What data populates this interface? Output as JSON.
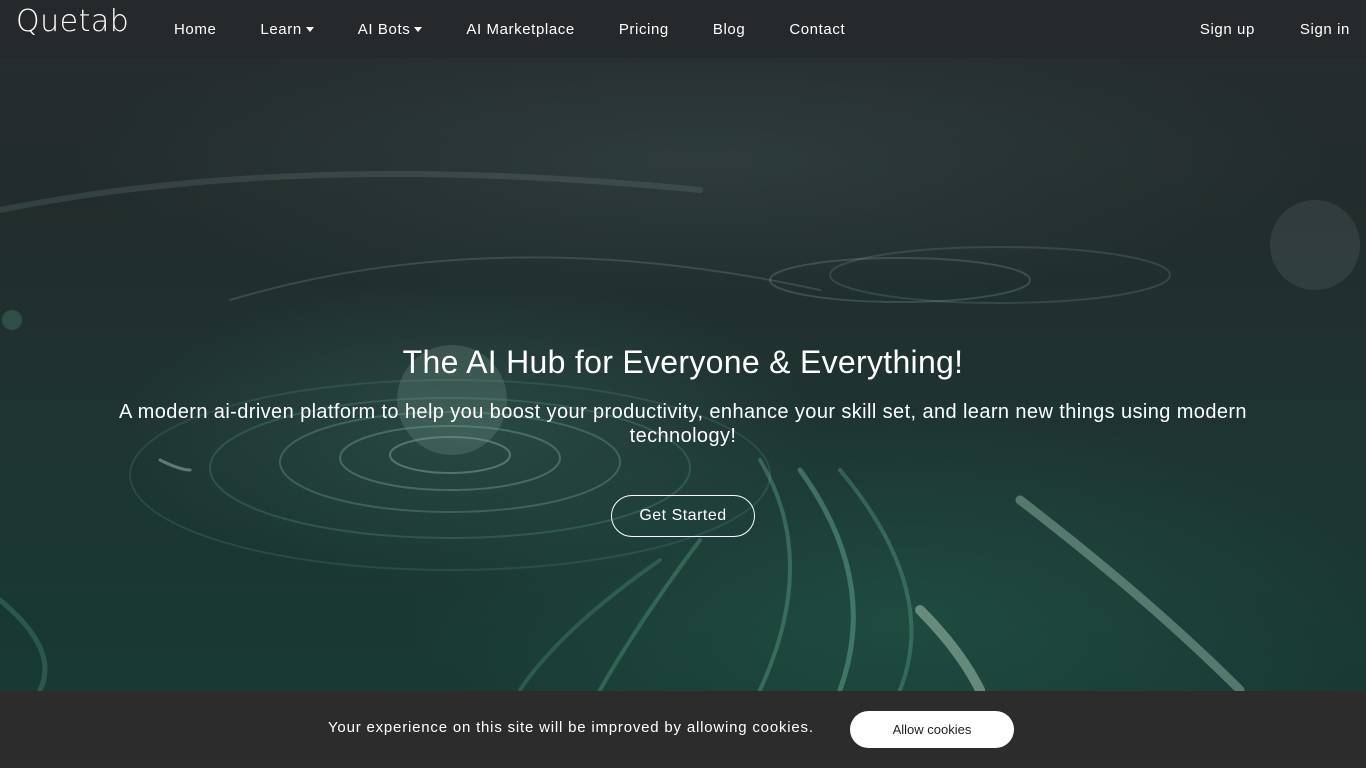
{
  "brand": {
    "logo_text": "Quetab"
  },
  "nav": {
    "items": [
      {
        "label": "Home",
        "dropdown": false
      },
      {
        "label": "Learn",
        "dropdown": true
      },
      {
        "label": "AI Bots",
        "dropdown": true
      },
      {
        "label": "AI Marketplace",
        "dropdown": false
      },
      {
        "label": "Pricing",
        "dropdown": false
      },
      {
        "label": "Blog",
        "dropdown": false
      },
      {
        "label": "Contact",
        "dropdown": false
      }
    ],
    "sign_up": "Sign up",
    "sign_in": "Sign in"
  },
  "hero": {
    "title": "The AI Hub for Everyone & Everything!",
    "subtitle": "A modern ai-driven platform to help you boost your productivity, enhance your skill set, and learn new things using modern technology!",
    "cta_label": "Get Started"
  },
  "cookie": {
    "message": "Your experience on this site will be improved by allowing cookies.",
    "button_label": "Allow cookies"
  },
  "colors": {
    "navbar_bg": "#25292c",
    "cookie_bar_bg": "#2c2c2c",
    "hero_accent": "#2f7a68"
  }
}
